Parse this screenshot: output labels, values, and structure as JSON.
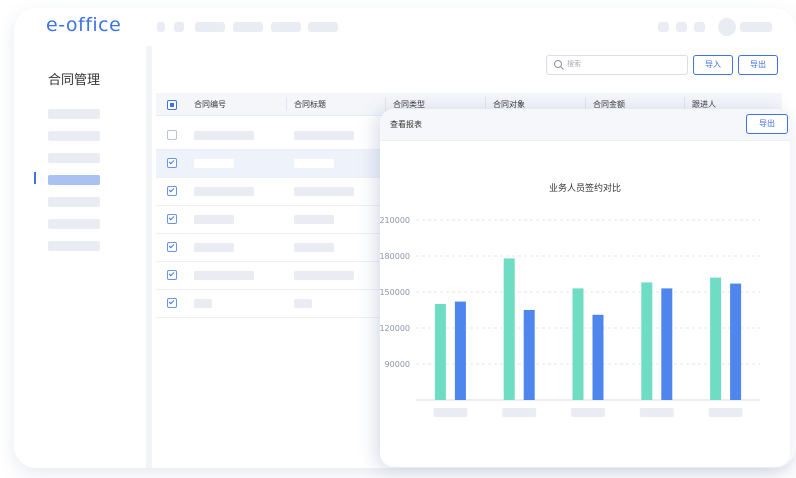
{
  "app": {
    "logo": "e-office"
  },
  "sidebar": {
    "title": "合同管理",
    "active_index": 3
  },
  "toolbar": {
    "search_placeholder": "搜索",
    "import_label": "导入",
    "export_label": "导出"
  },
  "table": {
    "select_all": "partial",
    "columns": [
      "合同编号",
      "合同标题",
      "合同类型",
      "合同对象",
      "合同金额",
      "跟进人"
    ],
    "rows": [
      {
        "checked": false,
        "selected": false
      },
      {
        "checked": true,
        "selected": true
      },
      {
        "checked": true,
        "selected": false
      },
      {
        "checked": true,
        "selected": false
      },
      {
        "checked": true,
        "selected": false
      },
      {
        "checked": true,
        "selected": false
      },
      {
        "checked": true,
        "selected": false
      }
    ]
  },
  "report_panel": {
    "title": "查看报表",
    "export_label": "导出"
  },
  "colors": {
    "accent": "#3d73e6",
    "series_teal": "#6fdcc4",
    "series_blue": "#4f86ee"
  },
  "chart_data": {
    "type": "bar",
    "title": "业务人员签约对比",
    "ylim": [
      60000,
      210000
    ],
    "yticks": [
      "90000",
      "120000",
      "150000",
      "180000",
      "210000"
    ],
    "grid": true,
    "category_count": 5,
    "series": [
      {
        "color": "#6fdcc4",
        "values": [
          140000,
          178000,
          153000,
          158000,
          162000
        ]
      },
      {
        "color": "#4f86ee",
        "values": [
          142000,
          135000,
          131000,
          153000,
          157000
        ]
      }
    ]
  }
}
